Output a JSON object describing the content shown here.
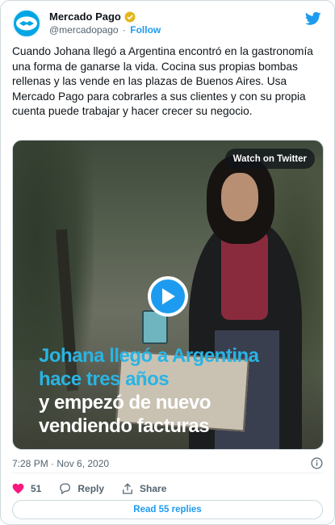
{
  "account": {
    "name": "Mercado Pago",
    "handle": "@mercadopago",
    "separator": "·",
    "follow_label": "Follow"
  },
  "tweet": {
    "text": "Cuando Johana llegó a Argentina encontró en la gastronomía una forma de ganarse la vida. Cocina sus propias bombas rellenas y las vende en las plazas de Buenos Aires. Usa Mercado Pago para cobrarles a sus clientes y con su propia cuenta puede trabajar y hacer crecer su negocio.",
    "timestamp": "7:28 PM · Nov 6, 2020"
  },
  "media": {
    "watch_label": "Watch on Twitter",
    "caption_line1": "Johana llegó a Argentina",
    "caption_line2": "hace tres años",
    "caption_line3": "y empezó de nuevo",
    "caption_line4": "vendiendo facturas"
  },
  "actions": {
    "likes_count": "51",
    "reply_label": "Reply",
    "share_label": "Share"
  },
  "replies": {
    "label": "Read 55 replies"
  },
  "colors": {
    "accent": "#1d9bf0",
    "like": "#f91880",
    "caption_blue": "#29b4e3",
    "verified": "#e2b719"
  },
  "icons": [
    "mercadopago-logo-icon",
    "verified-badge-icon",
    "twitter-bird-icon",
    "play-icon",
    "info-icon",
    "heart-icon",
    "reply-icon",
    "share-icon"
  ]
}
